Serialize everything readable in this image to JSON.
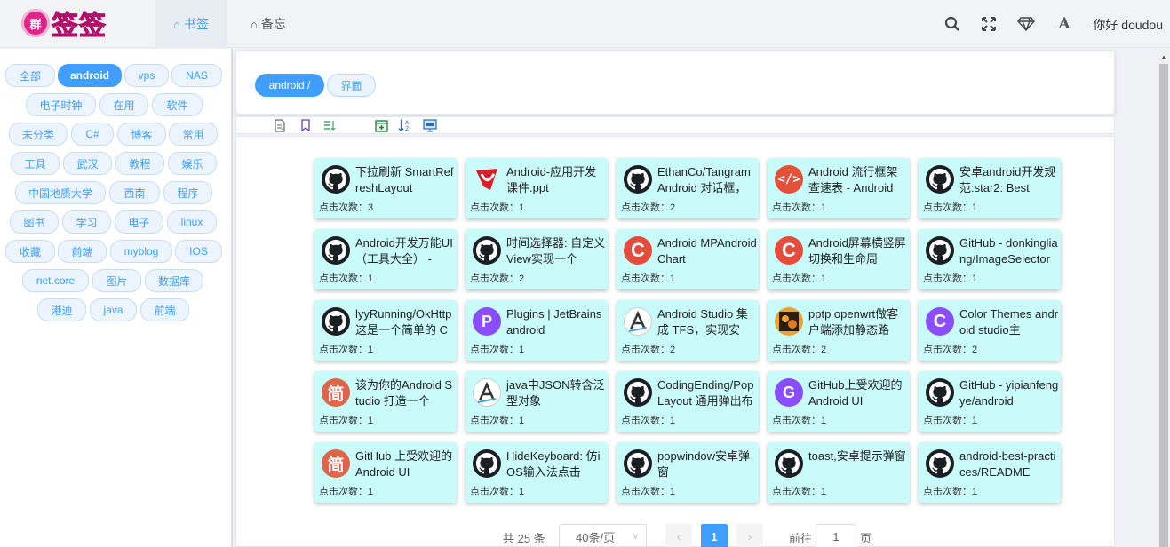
{
  "header": {
    "logo_badge": "群",
    "logo_text": "签签",
    "tabs": [
      {
        "label": "书签",
        "icon": "home-icon"
      },
      {
        "label": "备忘",
        "icon": "home-icon"
      }
    ],
    "greeting": "你好 doudou"
  },
  "sidebar": {
    "tags": [
      "全部",
      "android",
      "vps",
      "NAS",
      "电子时钟",
      "在用",
      "软件",
      "未分类",
      "C#",
      "博客",
      "常用",
      "工具",
      "武汉",
      "教程",
      "娱乐",
      "中国地质大学",
      "西南",
      "程序",
      "图书",
      "学习",
      "电子",
      "linux",
      "收藏",
      "前端",
      "myblog",
      "IOS",
      "net.core",
      "图片",
      "数据库",
      "港迪",
      "java",
      "前端"
    ],
    "active": "android"
  },
  "breadcrumb": {
    "items": [
      "android /",
      "界面"
    ]
  },
  "cards": [
    {
      "title": "下拉刷新 SmartRefreshLayout",
      "count_label": "点击次数：3",
      "icon": "github-icon"
    },
    {
      "title": "Android-应用开发课件.ppt",
      "count_label": "点击次数：1",
      "icon": "red-logo-icon"
    },
    {
      "title": "EthanCo/Tangram Android 对话框，封装",
      "count_label": "点击次数：2",
      "icon": "github-icon"
    },
    {
      "title": "Android 流行框架查速表 - Android",
      "count_label": "点击次数：1",
      "icon": "code-icon"
    },
    {
      "title": "安卓android开发规范:star2: Best",
      "count_label": "点击次数：1",
      "icon": "github-icon"
    },
    {
      "title": "Android开发万能UI（工具大全） -",
      "count_label": "点击次数：1",
      "icon": "github-icon"
    },
    {
      "title": "时间选择器: 自定义View实现一个",
      "count_label": "点击次数：2",
      "icon": "github-icon"
    },
    {
      "title": "Android MPAndroidChart",
      "count_label": "点击次数：1",
      "icon": "c-red-icon"
    },
    {
      "title": "Android屏幕横竖屏切换和生命周",
      "count_label": "点击次数：1",
      "icon": "c-red-icon"
    },
    {
      "title": "GitHub - donkingliang/ImageSelector",
      "count_label": "点击次数：1",
      "icon": "github-icon"
    },
    {
      "title": "lyyRunning/OkHttp 这是一个简单的 C",
      "count_label": "点击次数：1",
      "icon": "github-icon"
    },
    {
      "title": "Plugins | JetBrains android",
      "count_label": "点击次数：1",
      "icon": "p-purple-icon"
    },
    {
      "title": "Android Studio 集成 TFS，实现安",
      "count_label": "点击次数：2",
      "icon": "pen-icon"
    },
    {
      "title": "pptp openwrt做客户端添加静态路",
      "count_label": "点击次数：2",
      "icon": "photo-icon"
    },
    {
      "title": "Color Themes android studio主",
      "count_label": "点击次数：2",
      "icon": "c-purple-icon"
    },
    {
      "title": "该为你的Android Studio 打造一个",
      "count_label": "点击次数：1",
      "icon": "jian-icon"
    },
    {
      "title": "java中JSON转含泛型对象",
      "count_label": "点击次数：1",
      "icon": "pen-icon"
    },
    {
      "title": "CodingEnding/PopLayout 通用弹出布局辅助",
      "count_label": "点击次数：1",
      "icon": "github-icon"
    },
    {
      "title": "GitHub上受欢迎的Android UI",
      "count_label": "点击次数：1",
      "icon": "g-purple-icon"
    },
    {
      "title": "GitHub - yipianfengye/android",
      "count_label": "点击次数：1",
      "icon": "github-icon"
    },
    {
      "title": "GitHub 上受欢迎的 Android UI",
      "count_label": "点击次数：1",
      "icon": "jian-icon"
    },
    {
      "title": "HideKeyboard: 仿iOS输入法点击",
      "count_label": "点击次数：1",
      "icon": "github-icon"
    },
    {
      "title": "popwindow安卓弹窗",
      "count_label": "点击次数：1",
      "icon": "github-icon"
    },
    {
      "title": "toast,安卓提示弹窗",
      "count_label": "点击次数：1",
      "icon": "github-icon"
    },
    {
      "title": "android-best-practices/README",
      "count_label": "点击次数：1",
      "icon": "github-icon"
    }
  ],
  "pagination": {
    "total": "共 25 条",
    "page_size": "40条/页",
    "current": "1",
    "goto_label": "前往",
    "goto_value": "1",
    "goto_suffix": "页"
  }
}
